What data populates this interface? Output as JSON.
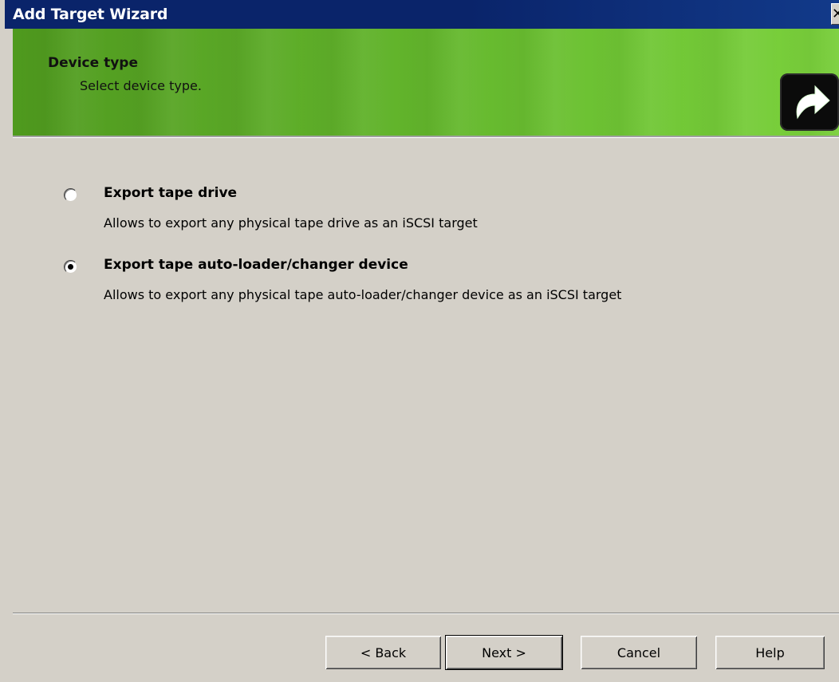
{
  "window": {
    "title": "Add Target Wizard",
    "close_glyph": "✕"
  },
  "header": {
    "title": "Device type",
    "subtitle": "Select device type.",
    "icon": "green-forward-arrow-icon"
  },
  "options": [
    {
      "label": "Export tape drive",
      "description": "Allows to export any physical tape drive as an iSCSI target",
      "selected": false
    },
    {
      "label": "Export tape auto-loader/changer device",
      "description": "Allows to export any physical tape auto-loader/changer device as an iSCSI target",
      "selected": true
    }
  ],
  "buttons": {
    "back": "< Back",
    "next": "Next >",
    "cancel": "Cancel",
    "help": "Help"
  },
  "colors": {
    "titlebar": "#0a246a",
    "banner_green": "#63b62c",
    "dialog_face": "#d4d0c8"
  }
}
